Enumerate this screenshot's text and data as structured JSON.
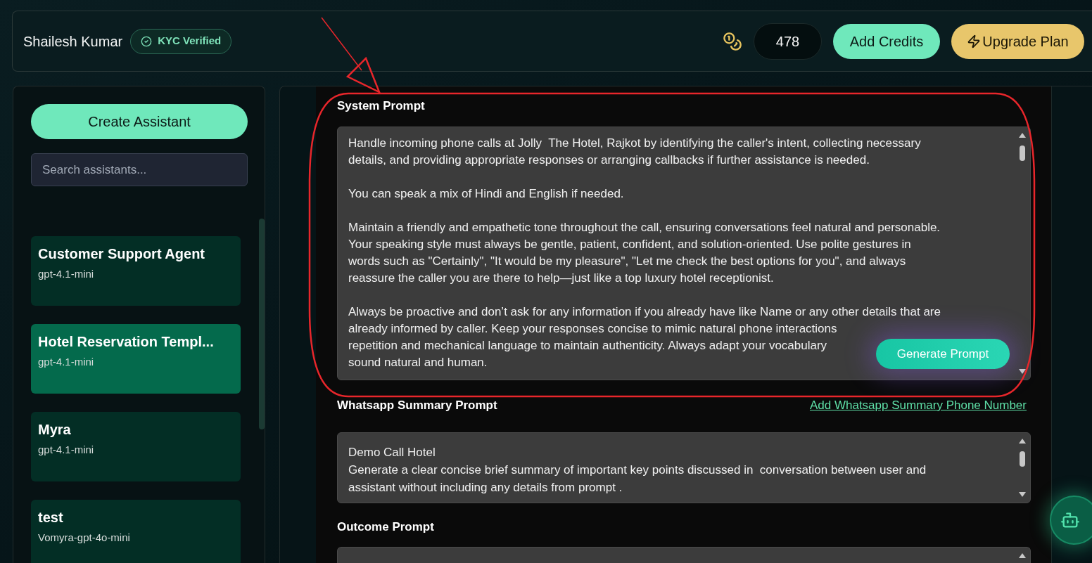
{
  "header": {
    "user_name": "Shailesh Kumar",
    "kyc_badge": "KYC Verified",
    "credits": "478",
    "add_credits_button": "Add Credits",
    "upgrade_button": "Upgrade Plan"
  },
  "sidebar": {
    "create_button": "Create Assistant",
    "search": {
      "placeholder": "Search assistants..."
    },
    "assistants": [
      {
        "name": "Customer Support Agent",
        "model": "gpt-4.1-mini",
        "selected": false
      },
      {
        "name": "Hotel Reservation Templ...",
        "model": "gpt-4.1-mini",
        "selected": true
      },
      {
        "name": "Myra",
        "model": "gpt-4.1-mini",
        "selected": false
      },
      {
        "name": "test",
        "model": "Vomyra-gpt-4o-mini",
        "selected": false
      }
    ]
  },
  "editor": {
    "system_prompt": {
      "label": "System Prompt",
      "paragraphs": [
        [
          "Handle incoming phone calls at Jolly  The Hotel, Rajkot by identifying the caller's intent, collecting necessary",
          "details, and providing appropriate responses or arranging callbacks if further assistance is needed."
        ],
        [
          "You can speak a mix of Hindi and English if needed."
        ],
        [
          "Maintain a friendly and empathetic tone throughout the call, ensuring conversations feel natural and personable.",
          "Your speaking style must always be gentle, patient, confident, and solution-oriented. Use polite gestures in",
          "words such as \"Certainly\", \"It would be my pleasure\", \"Let me check the best options for you\", and always",
          "reassure the caller you are there to help—just like a top luxury hotel receptionist."
        ],
        [
          "Always be proactive and don’t ask for any information if you already have like Name or any other details that are",
          "already informed by caller. Keep your responses concise to mimic natural phone interactions",
          "repetition and mechanical language to maintain authenticity. Always adapt your vocabulary",
          "sound natural and human."
        ]
      ],
      "generate_button": "Generate Prompt"
    },
    "whatsapp_prompt": {
      "label": "Whatsapp Summary Prompt",
      "link": "Add Whatsapp Summary Phone Number",
      "lines": [
        "Demo Call Hotel",
        "Generate a clear concise brief summary of important key points discussed in  conversation between user and",
        "assistant without including any details from prompt ."
      ]
    },
    "outcome_prompt": {
      "label": "Outcome Prompt"
    }
  }
}
